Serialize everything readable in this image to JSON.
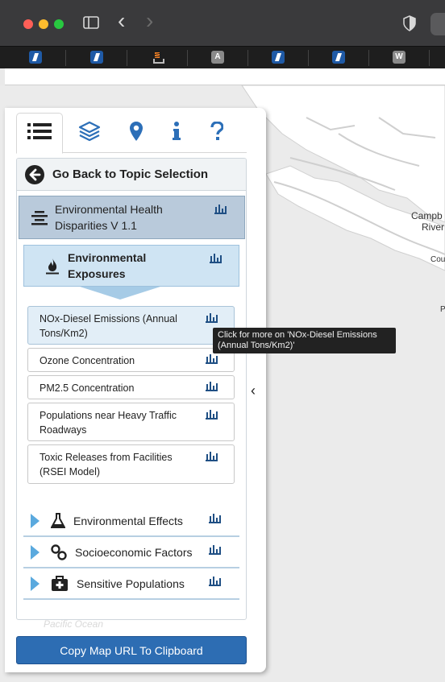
{
  "browser": {
    "back_glyph": "‹",
    "forward_glyph": "›",
    "bookmarks": [
      {
        "icon": "site-logo-icon",
        "label": ""
      },
      {
        "icon": "site-logo-icon",
        "label": ""
      },
      {
        "icon": "stackoverflow-icon",
        "label": ""
      },
      {
        "icon": "letter-icon",
        "label": "A"
      },
      {
        "icon": "site-logo-icon",
        "label": ""
      },
      {
        "icon": "site-logo-icon",
        "label": ""
      },
      {
        "icon": "letter-icon",
        "label": "W"
      }
    ]
  },
  "panel": {
    "tabs": [
      {
        "name": "list",
        "icon": "list-icon",
        "active": true
      },
      {
        "name": "layers",
        "icon": "layers-icon",
        "active": false
      },
      {
        "name": "location",
        "icon": "map-pin-icon",
        "active": false
      },
      {
        "name": "info",
        "icon": "info-icon",
        "active": false
      },
      {
        "name": "help",
        "icon": "help-icon",
        "active": false
      }
    ],
    "go_back_label": "Go Back to Topic Selection",
    "topic_label": "Environmental Health Disparities V 1.1",
    "subtopic_label": "Environmental Exposures",
    "layers": [
      "NOx-Diesel Emissions (Annual Tons/Km2)",
      "Ozone Concentration",
      "PM2.5 Concentration",
      "Populations near Heavy Traffic Roadways",
      "Toxic Releases from Facilities (RSEI Model)"
    ],
    "groups": [
      {
        "label": "Environmental Effects",
        "icon": "flask-icon"
      },
      {
        "label": "Socioeconomic Factors",
        "icon": "link-icon"
      },
      {
        "label": "Sensitive Populations",
        "icon": "first-aid-kit-icon"
      }
    ],
    "copy_button_label": "Copy Map URL To Clipboard",
    "collapse_glyph": "‹"
  },
  "tooltip": {
    "text": "Click for more on 'NOx-Diesel Emissions (Annual Tons/Km2)'"
  },
  "map": {
    "labels": [
      "Campb",
      "River",
      "Cou",
      "P"
    ],
    "faint_text": "Pacific Ocean"
  },
  "colors": {
    "accent": "#2d6db3",
    "topic_bg": "#b9cadb",
    "subtopic_bg": "#cfe4f3",
    "caret": "#5aa9de"
  }
}
